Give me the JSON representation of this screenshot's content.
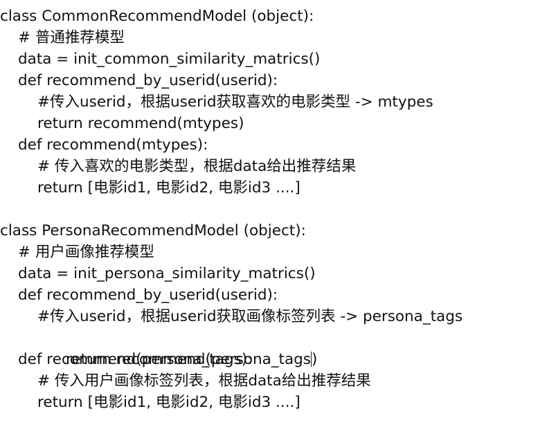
{
  "blocks": [
    {
      "lines": [
        {
          "indent": 0,
          "text": "class CommonRecommendModel (object):"
        },
        {
          "indent": 1,
          "text": "# 普通推荐模型"
        },
        {
          "indent": 1,
          "text": "data = init_common_similarity_matrics()"
        },
        {
          "indent": 1,
          "text": "def recommend_by_userid(userid):"
        },
        {
          "indent": 2,
          "text": "#传入userid，根据userid获取喜欢的电影类型 -> mtypes"
        },
        {
          "indent": 2,
          "text": "return recommend(mtypes)"
        },
        {
          "indent": 1,
          "text": "def recommend(mtypes):"
        },
        {
          "indent": 2,
          "text": "# 传入喜欢的电影类型，根据data给出推荐结果"
        },
        {
          "indent": 2,
          "text": "return [电影id1, 电影id2, 电影id3 ....]"
        }
      ]
    },
    {
      "lines": [
        {
          "indent": 0,
          "text": "class PersonaRecommendModel (object):"
        },
        {
          "indent": 1,
          "text": "# 用户画像推荐模型"
        },
        {
          "indent": 1,
          "text": "data = init_persona_similarity_matrics()"
        },
        {
          "indent": 1,
          "text": "def recommend_by_userid(userid):"
        },
        {
          "indent": 2,
          "text": "#传入userid，根据userid获取画像标签列表 -> persona_tags"
        },
        {
          "indent": 2,
          "text": "return recommend(persona_tags)",
          "cursor_after": "return recommend(persona_tags",
          "cursor_rest": ")"
        },
        {
          "indent": 1,
          "text": "def recommend(persona_tags):"
        },
        {
          "indent": 2,
          "text": "# 传入用户画像标签列表，根据data给出推荐结果"
        },
        {
          "indent": 2,
          "text": "return [电影id1, 电影id2, 电影id3 ....]"
        }
      ]
    }
  ]
}
